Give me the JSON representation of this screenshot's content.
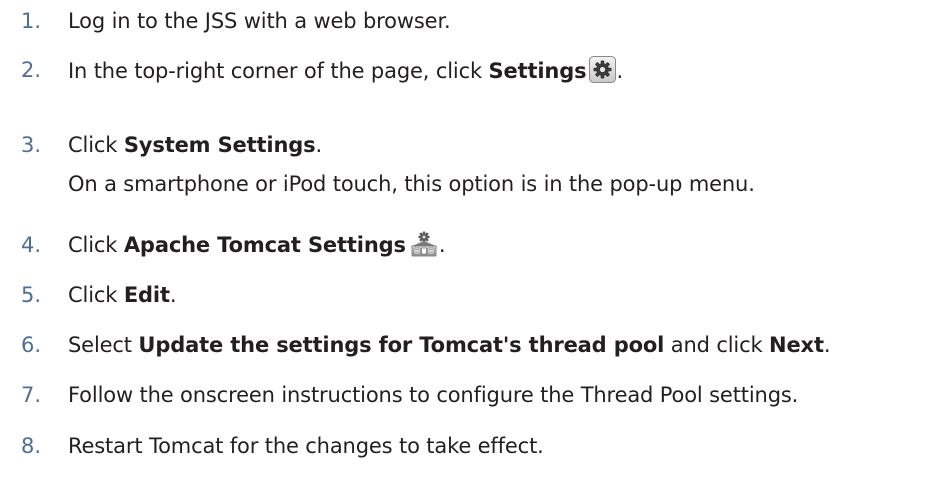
{
  "colors": {
    "number": "#4d6f95",
    "text": "#231f20"
  },
  "steps": [
    {
      "num": "1.",
      "text": "Log in to the JSS with a web browser."
    },
    {
      "num": "2.",
      "pre": "In the top-right corner of the page, click ",
      "bold": "Settings",
      "icon": "gear-icon",
      "post": "."
    },
    {
      "num": "3.",
      "pre": "Click ",
      "bold": "System Settings",
      "post": ".",
      "sub": "On a smartphone or iPod touch, this option is in the pop-up menu."
    },
    {
      "num": "4.",
      "pre": "Click ",
      "bold": "Apache Tomcat Settings",
      "icon": "server-settings-icon",
      "post": "."
    },
    {
      "num": "5.",
      "pre": "Click ",
      "bold": "Edit",
      "post": "."
    },
    {
      "num": "6.",
      "pre": "Select ",
      "bold": "Update the settings for Tomcat's thread pool",
      "mid": " and click ",
      "bold2": "Next",
      "post": "."
    },
    {
      "num": "7.",
      "text": "Follow the onscreen instructions to configure the Thread Pool settings."
    },
    {
      "num": "8.",
      "text": "Restart Tomcat for the changes to take effect."
    }
  ]
}
